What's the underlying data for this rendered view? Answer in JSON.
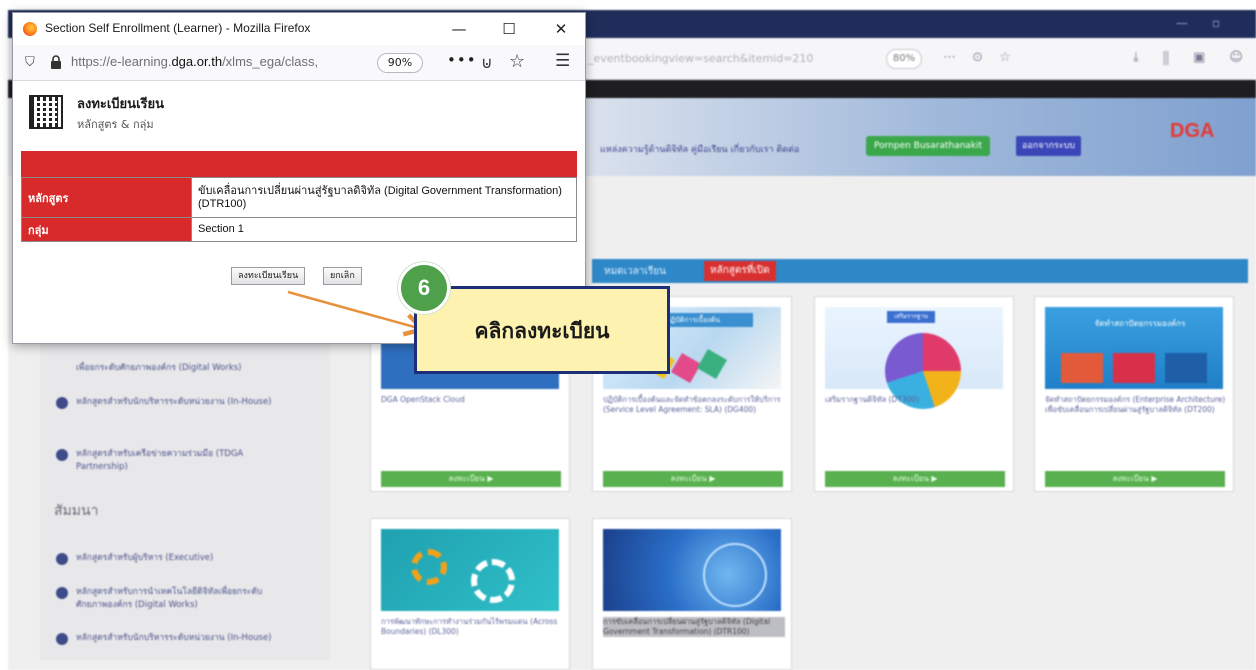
{
  "popup": {
    "title": "Section Self Enrollment (Learner) - Mozilla Firefox",
    "url_prefix": "https://e-learning.",
    "url_domain": "dga.or.th",
    "url_path": "/xlms_ega/class,",
    "zoom": "90%",
    "heading": "ลงทะเบียนเรียน",
    "subheading": "หลักสูตร & กลุ่ม",
    "rows": [
      {
        "label": "หลักสูตร",
        "value": "ขับเคลื่อนการเปลี่ยนผ่านสู่รัฐบาลดิจิทัล (Digital Government Transformation) (DTR100)"
      },
      {
        "label": "กลุ่ม",
        "value": "Section 1"
      }
    ],
    "register_button": "ลงทะเบียนเรียน",
    "cancel_button": "ยกเลิก"
  },
  "annotation": {
    "step": "6",
    "text": "คลิกลงทะเบียน"
  },
  "background": {
    "logo": "DGA",
    "zoom": "80%",
    "url_fragment": "_eventbookingview=search&itemid=210",
    "menu_text": "แหล่งความรู้ด้านดิจิทัล  คู่มือเรียน  เกี่ยวกับเรา  ติดต่อ",
    "user_name": "Pornpen Busarathanakit",
    "logout": "ออกจากระบบ",
    "tab_calendar": "หมดเวลาเรียน",
    "tab_open": "หลักสูตรที่เปิด",
    "sidebar_heading": "สัมมนา",
    "sidebar_items_top": [
      "เพื่อยกระดับศักยภาพองค์กร (Digital Works)",
      "หลักสูตรสำหรับนักบริหารระดับหน่วยงาน (In-House)",
      "หลักสูตรสำหรับเครือข่ายความร่วมมือ (TDGA Partnership)"
    ],
    "sidebar_items_bottom": [
      "หลักสูตรสำหรับผู้บริหาร (Executive)",
      "หลักสูตรสำหรับการนำเทคโนโลยีดิจิทัลเพื่อยกระดับศักยภาพองค์กร (Digital Works)",
      "หลักสูตรสำหรับนักบริหารระดับหน่วยงาน (In-House)"
    ],
    "cards": [
      {
        "desc": "DGA OpenStack Cloud",
        "btn": "ลงทะเบียน ▶"
      },
      {
        "desc": "ปฏิบัติการเบื้องต้นและจัดทำข้อตกลงระดับการให้บริการ (Service Level Agreement: SLA) (DG400)",
        "btn": "ลงทะเบียน ▶"
      },
      {
        "desc": "เสริมรากฐานดิจิทัล (DT300)",
        "btn": "ลงทะเบียน ▶"
      },
      {
        "desc": "จัดทำสถาปัตยกรรมองค์กร (Enterprise Architecture) เพื่อขับเคลื่อนการเปลี่ยนผ่านสู่รัฐบาลดิจิทัล (DT200)",
        "btn": "ลงทะเบียน ▶"
      },
      {
        "desc": "การพัฒนาทักษะการทำงานร่วมกันไร้พรมแดน (Across Boundaries) (DL300)"
      },
      {
        "desc": "การขับเคลื่อนการเปลี่ยนผ่านสู่รัฐบาลดิจิทัล (Digital Government Transformation) (DTR100)"
      }
    ],
    "card_banner_1": "ปฏิบัติการเบื้องต้น",
    "card_banner_2": "เสริมรากฐาน",
    "card_banner_3": "จัดทำสถาปัตยกรรมองค์กร"
  },
  "colors": {
    "accent_red": "#d82a2a",
    "annotation_bg": "#fdf2b0",
    "annotation_border": "#1e2f7a",
    "badge_green": "#4fa04a",
    "arrow": "#e8913c"
  }
}
